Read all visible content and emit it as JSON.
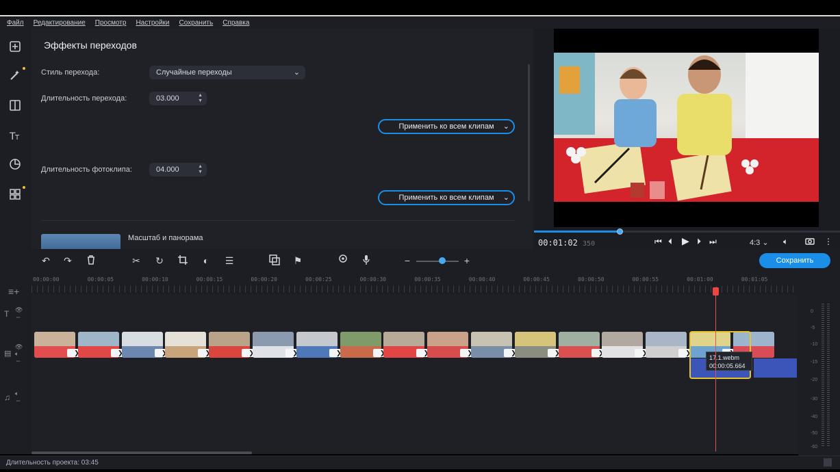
{
  "menu": [
    "Файл",
    "Редактирование",
    "Просмотр",
    "Настройки",
    "Сохранить",
    "Справка"
  ],
  "panel": {
    "title": "Эффекты переходов",
    "style_label": "Стиль перехода:",
    "style_value": "Случайные переходы",
    "duration_label": "Длительность перехода:",
    "duration_value": "03.000",
    "apply_label": "Применить ко всем клипам",
    "photo_label": "Длительность фотоклипа:",
    "photo_value": "04.000",
    "apply_label_2": "Применить ко всем клипам",
    "effect_name": "Масштаб и панорама"
  },
  "player": {
    "timecode": "00:01:02",
    "timecode_frames": "350",
    "progress": 0.28,
    "aspect": "4:3"
  },
  "toolbar": {
    "save_label": "Сохранить"
  },
  "ruler": {
    "labels": [
      "00:00:00",
      "00:00:05",
      "00:00:10",
      "00:00:15",
      "00:00:20",
      "00:00:25",
      "00:00:30",
      "00:00:35",
      "00:00:40",
      "00:00:45",
      "00:00:50",
      "00:00:55",
      "00:01:00",
      "00:01:05"
    ]
  },
  "timeline": {
    "tooltip_name": "17.1.webm",
    "tooltip_time": "00:00:05.664"
  },
  "meter_labels": [
    "0",
    "-5",
    "-10",
    "-15",
    "-20",
    "-30",
    "-40",
    "-50",
    "-60"
  ],
  "status": {
    "project_duration": "Длительность проекта: 03:45"
  },
  "colors": {
    "accent": "#1b8fe8",
    "selection": "#e8c42c",
    "playhead": "#e05050"
  }
}
